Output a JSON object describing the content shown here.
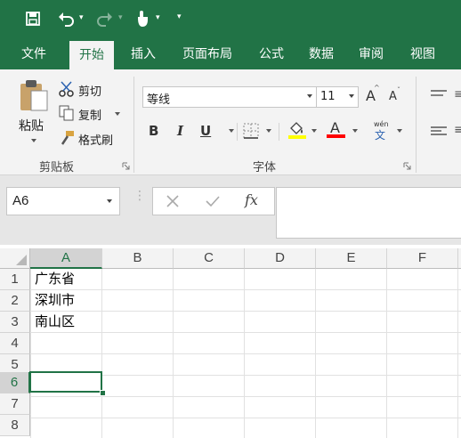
{
  "colors": {
    "accent": "#217346",
    "ribbon_bg": "#f3f3f3",
    "selection": "#217346",
    "fill_yellow": "#ffff00",
    "font_red": "#ff0000"
  },
  "quick_access": {
    "icons": [
      "save-icon",
      "undo-icon",
      "redo-icon",
      "touch-mode-icon",
      "customize-icon"
    ]
  },
  "tabs": [
    "文件",
    "开始",
    "插入",
    "页面布局",
    "公式",
    "数据",
    "审阅",
    "视图"
  ],
  "active_tab": "开始",
  "clipboard": {
    "paste": "粘贴",
    "cut": "剪切",
    "copy": "复制",
    "format_painter": "格式刷",
    "group_label": "剪贴板"
  },
  "font": {
    "name": "等线",
    "size": "11",
    "grow": "A",
    "shrink": "A",
    "bold": "B",
    "italic": "I",
    "underline": "U",
    "font_color_letter": "A",
    "wen_top": "wén",
    "wen_bottom": "文",
    "group_label": "字体"
  },
  "formula_bar": {
    "name_box": "A6",
    "fx": "fx",
    "content": ""
  },
  "sheet": {
    "columns": [
      "A",
      "B",
      "C",
      "D",
      "E",
      "F"
    ],
    "rows": [
      "1",
      "2",
      "3",
      "4",
      "5",
      "6",
      "7",
      "8"
    ],
    "cells": {
      "A1": "广东省",
      "A2": "深圳市",
      "A3": "南山区"
    },
    "selected_cell": "A6"
  }
}
